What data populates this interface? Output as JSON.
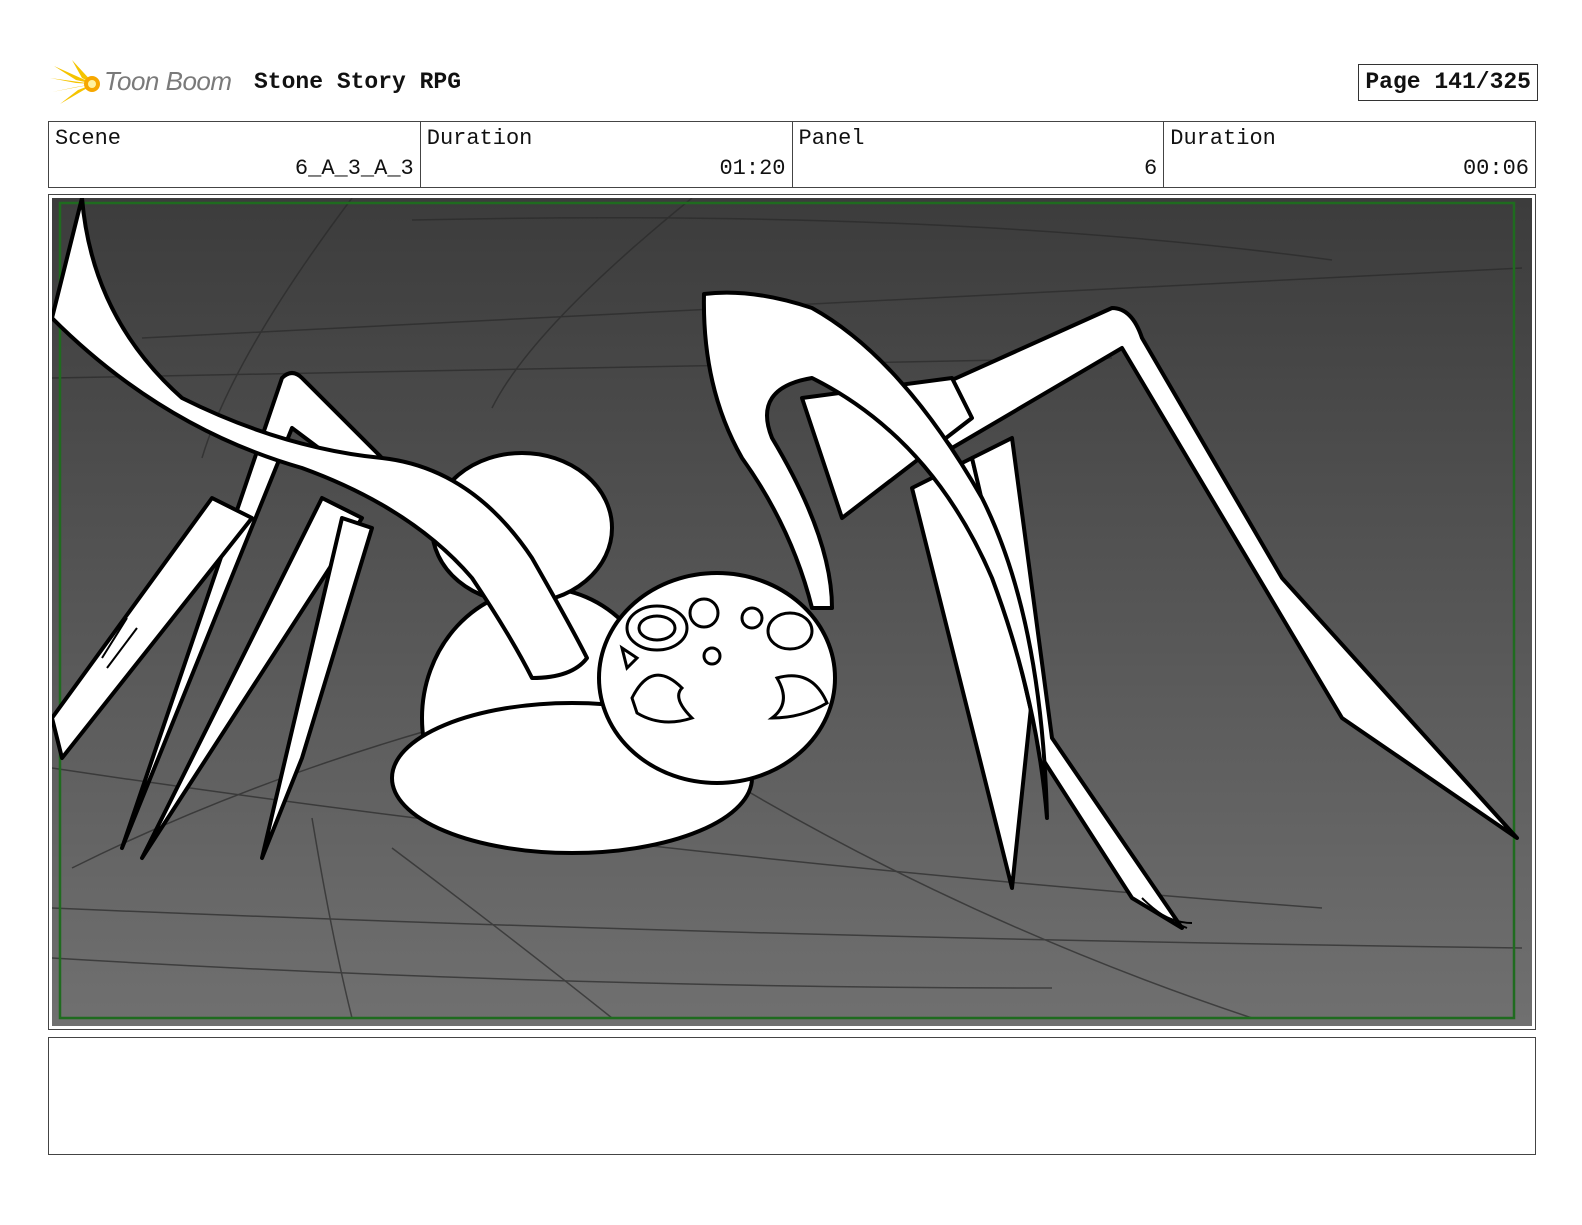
{
  "header": {
    "logo_text": "Toon Boom",
    "project_title": "Stone Story RPG",
    "page_label": "Page 141/325"
  },
  "info": [
    {
      "label": "Scene",
      "value": "6_A_3_A_3"
    },
    {
      "label": "Duration",
      "value": "01:20"
    },
    {
      "label": "Panel",
      "value": "6"
    },
    {
      "label": "Duration",
      "value": "00:06"
    }
  ],
  "panel": {
    "subject_icon": "spider-sketch",
    "background_gradient": [
      "#3e3e3e",
      "#6e6e6e"
    ],
    "safe_frame_color": "#1f6b1f"
  },
  "notes": {
    "text": ""
  }
}
